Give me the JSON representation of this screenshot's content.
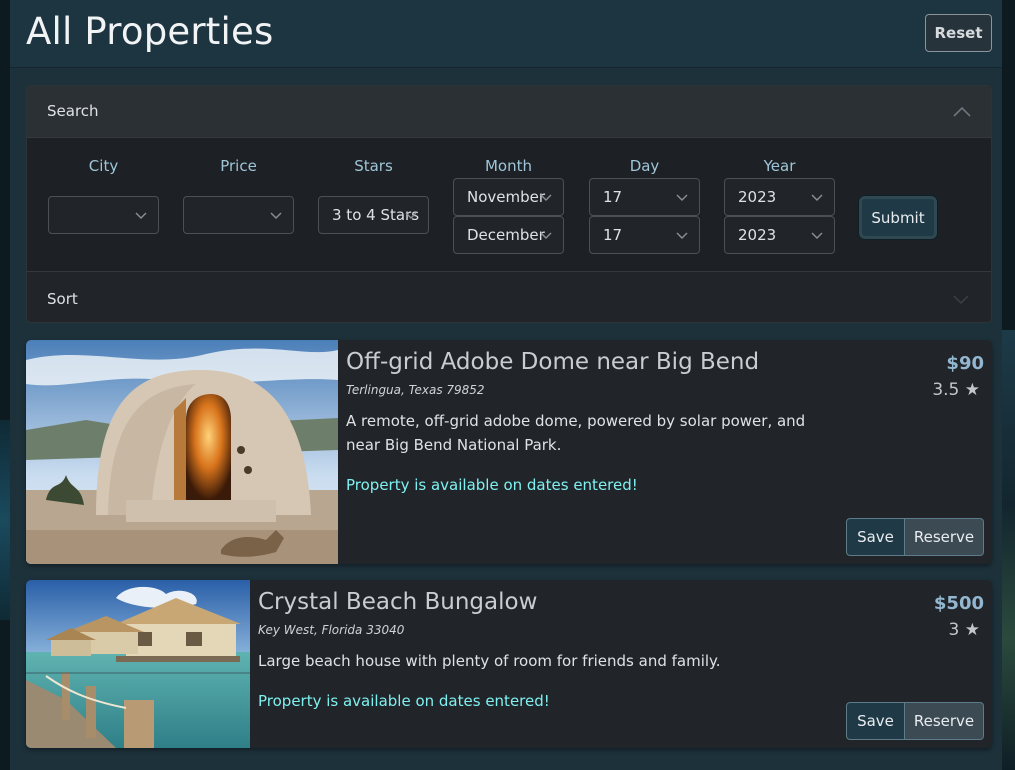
{
  "header": {
    "title": "All Properties",
    "reset_label": "Reset"
  },
  "search": {
    "title": "Search",
    "fields": {
      "city": {
        "label": "City",
        "value": ""
      },
      "price": {
        "label": "Price",
        "value": ""
      },
      "stars": {
        "label": "Stars",
        "value": "3 to 4 Stars"
      },
      "month": {
        "label": "Month",
        "start": "November",
        "end": "December"
      },
      "day": {
        "label": "Day",
        "start": "17",
        "end": "17"
      },
      "year": {
        "label": "Year",
        "start": "2023",
        "end": "2023"
      }
    },
    "submit_label": "Submit"
  },
  "sort": {
    "title": "Sort"
  },
  "properties": [
    {
      "title": "Off-grid Adobe Dome near Big Bend",
      "location": "Terlingua, Texas 79852",
      "description": "A remote, off-grid adobe dome, powered by solar power, and near Big Bend National Park.",
      "availability": "Property is available on dates entered!",
      "price": "$90",
      "stars": "3.5 ★",
      "save_label": "Save",
      "reserve_label": "Reserve"
    },
    {
      "title": "Crystal Beach Bungalow",
      "location": "Key West, Florida 33040",
      "description": "Large beach house with plenty of room for friends and family.",
      "availability": "Property is available on dates entered!",
      "price": "$500",
      "stars": "3 ★",
      "save_label": "Save",
      "reserve_label": "Reserve"
    }
  ],
  "colors": {
    "accent_label": "#9ec5d8",
    "availability": "#7ff0f0",
    "price": "#93b7d0",
    "button_primary": "#1f3a46"
  }
}
